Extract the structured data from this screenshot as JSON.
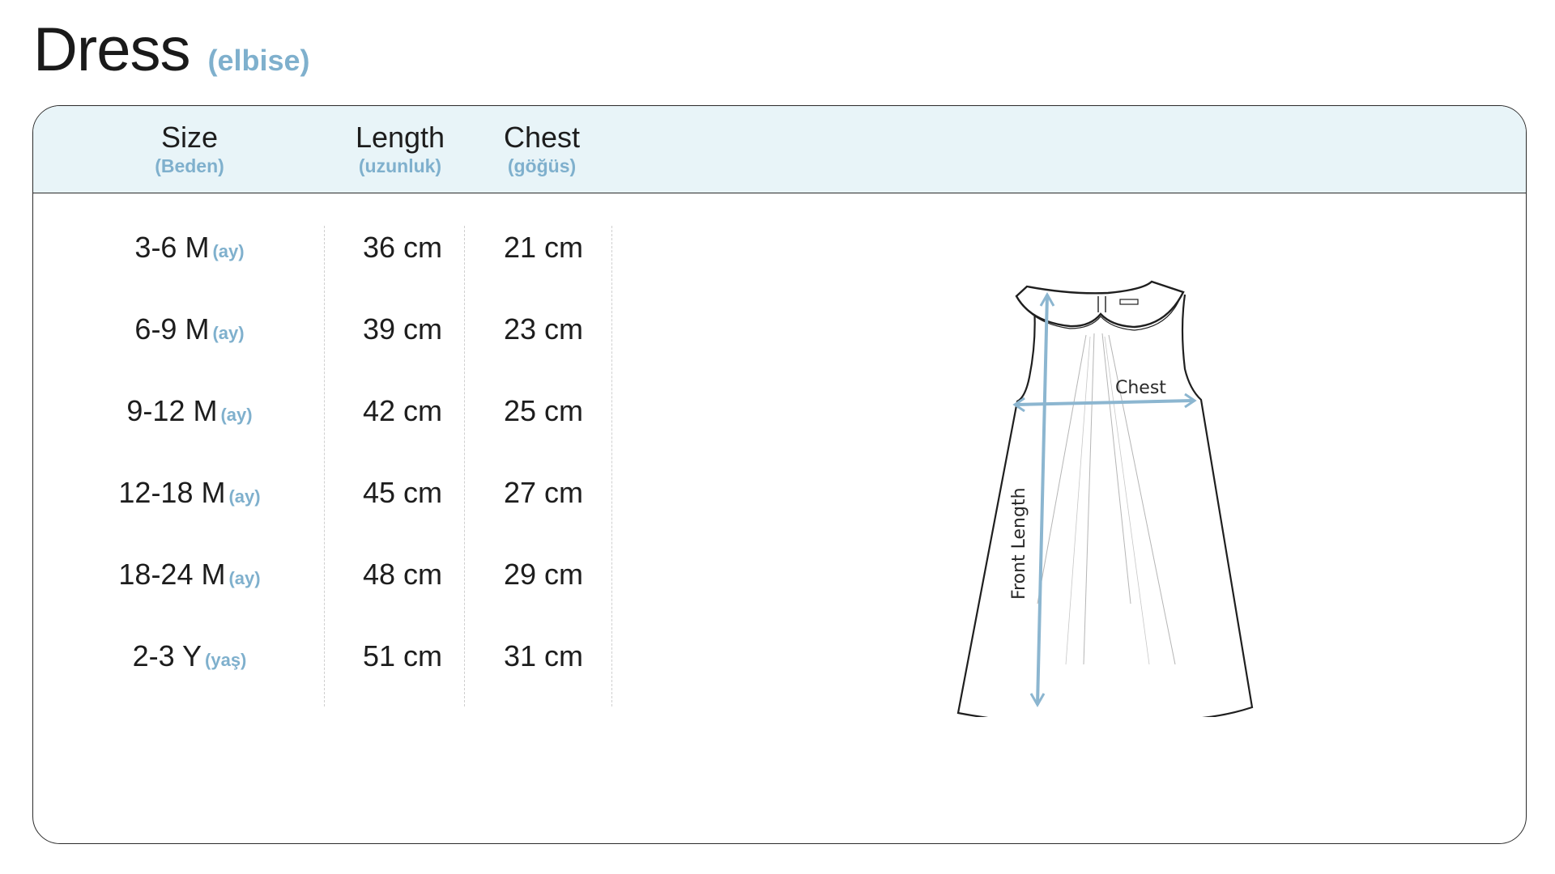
{
  "title": {
    "main": "Dress",
    "sub": "(elbise)"
  },
  "columns": [
    {
      "label": "Size",
      "sub": "(Beden)"
    },
    {
      "label": "Length",
      "sub": "(uzunluk)"
    },
    {
      "label": "Chest",
      "sub": "(göğüs)"
    }
  ],
  "rows": [
    {
      "size": "3-6 M",
      "unit": "(ay)",
      "length": "36 cm",
      "chest": "21 cm"
    },
    {
      "size": "6-9 M",
      "unit": "(ay)",
      "length": "39 cm",
      "chest": "23 cm"
    },
    {
      "size": "9-12 M",
      "unit": "(ay)",
      "length": "42 cm",
      "chest": "25 cm"
    },
    {
      "size": "12-18 M",
      "unit": "(ay)",
      "length": "45 cm",
      "chest": "27 cm"
    },
    {
      "size": "18-24 M",
      "unit": "(ay)",
      "length": "48 cm",
      "chest": "29 cm"
    },
    {
      "size": "2-3 Y",
      "unit": "(yaş)",
      "length": "51 cm",
      "chest": "31 cm"
    }
  ],
  "illustration": {
    "chest_label": "Chest",
    "length_label": "Front Length",
    "measure_color": "#8cb6d0"
  },
  "colors": {
    "accent": "#7fb0cd",
    "header_bg": "#e8f4f8",
    "text": "#1d1d1d"
  }
}
